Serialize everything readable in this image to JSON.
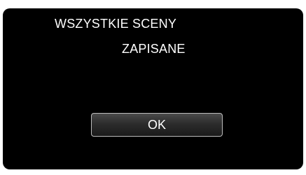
{
  "message": {
    "line1": "WSZYSTKIE SCENY",
    "line2": "ZAPISANE"
  },
  "ok_button": {
    "label": "OK"
  }
}
